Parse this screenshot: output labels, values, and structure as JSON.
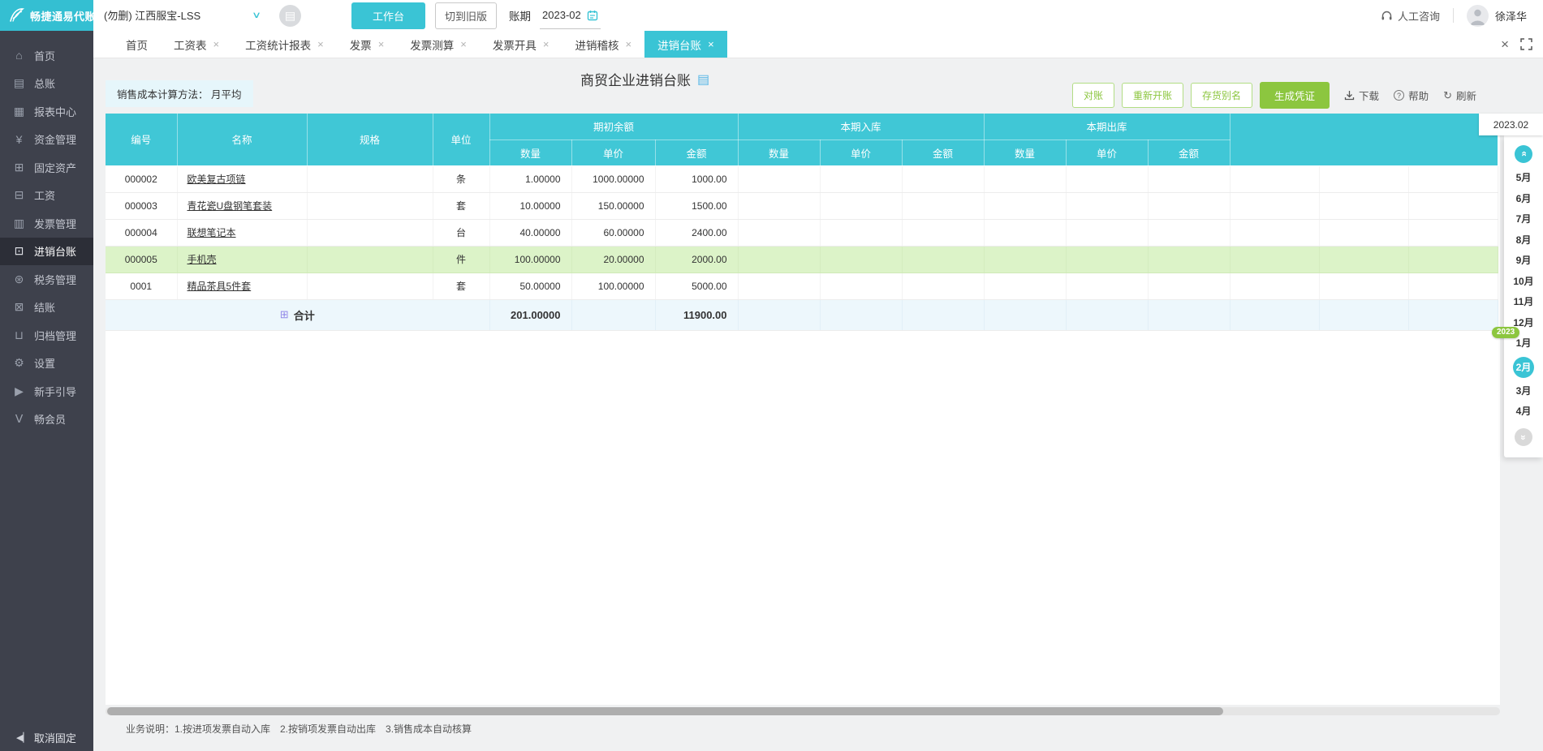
{
  "brand": {
    "name": "畅捷通易代账"
  },
  "topbar": {
    "company": "(勿删) 江西服宝-LSS",
    "workbench": "工作台",
    "switch_old": "切到旧版",
    "period_label": "账期",
    "period_value": "2023-02",
    "support": "人工咨询",
    "user": "徐泽华"
  },
  "sidebar": {
    "items": [
      {
        "label": "首页",
        "icon": "home-icon"
      },
      {
        "label": "总账",
        "icon": "ledger-icon"
      },
      {
        "label": "报表中心",
        "icon": "report-center-icon"
      },
      {
        "label": "资金管理",
        "icon": "funds-icon"
      },
      {
        "label": "固定资产",
        "icon": "fixed-assets-icon"
      },
      {
        "label": "工资",
        "icon": "payroll-icon"
      },
      {
        "label": "发票管理",
        "icon": "invoice-icon"
      },
      {
        "label": "进销台账",
        "icon": "inventory-ledger-icon"
      },
      {
        "label": "税务管理",
        "icon": "tax-icon"
      },
      {
        "label": "结账",
        "icon": "closing-icon"
      },
      {
        "label": "归档管理",
        "icon": "archive-icon"
      },
      {
        "label": "设置",
        "icon": "settings-icon"
      },
      {
        "label": "新手引导",
        "icon": "guide-icon"
      },
      {
        "label": "畅会员",
        "icon": "member-icon"
      }
    ],
    "unpin": "取消固定"
  },
  "tabs": [
    {
      "label": "首页"
    },
    {
      "label": "工资表"
    },
    {
      "label": "工资统计报表"
    },
    {
      "label": "发票"
    },
    {
      "label": "发票测算"
    },
    {
      "label": "发票开具"
    },
    {
      "label": "进销稽核"
    },
    {
      "label": "进销台账"
    }
  ],
  "page": {
    "cost_method_label": "销售成本计算方法：",
    "cost_method_value": "月平均",
    "title": "商贸企业进销台账"
  },
  "toolbar": {
    "reconcile": "对账",
    "reopen": "重新开账",
    "stock_alias": "存货别名",
    "make_voucher": "生成凭证",
    "download": "下载",
    "help": "帮助",
    "refresh": "刷新"
  },
  "table": {
    "head": {
      "code": "编号",
      "name": "名称",
      "spec": "规格",
      "unit": "单位"
    },
    "groups": [
      {
        "label": "期初余额",
        "cols": [
          "数量",
          "单价",
          "金额"
        ]
      },
      {
        "label": "本期入库",
        "cols": [
          "数量",
          "单价",
          "金额"
        ]
      },
      {
        "label": "本期出库",
        "cols": [
          "数量",
          "单价",
          "金额"
        ]
      }
    ],
    "rows": [
      {
        "code": "000002",
        "name": "欧美复古项链",
        "spec": "",
        "unit": "条",
        "qty": "1.00000",
        "price": "1000.00000",
        "amount": "1000.00"
      },
      {
        "code": "000003",
        "name": "青花瓷U盘钢笔套装",
        "spec": "",
        "unit": "套",
        "qty": "10.00000",
        "price": "150.00000",
        "amount": "1500.00"
      },
      {
        "code": "000004",
        "name": "联想笔记本",
        "spec": "",
        "unit": "台",
        "qty": "40.00000",
        "price": "60.00000",
        "amount": "2400.00"
      },
      {
        "code": "000005",
        "name": "手机壳",
        "spec": "",
        "unit": "件",
        "qty": "100.00000",
        "price": "20.00000",
        "amount": "2000.00"
      },
      {
        "code": "0001",
        "name": "精品茶具5件套",
        "spec": "",
        "unit": "套",
        "qty": "50.00000",
        "price": "100.00000",
        "amount": "5000.00"
      }
    ],
    "total": {
      "label": "合计",
      "qty": "201.00000",
      "amount": "11900.00"
    }
  },
  "footer": {
    "note": "业务说明：1.按进项发票自动入库　2.按销项发票自动出库　3.销售成本自动核算"
  },
  "calendar": {
    "period": "2023.02",
    "months_top": [
      "5月",
      "6月",
      "7月",
      "8月",
      "9月",
      "10月",
      "11月",
      "12月"
    ],
    "year_badge": "2023",
    "months_bottom": [
      "1月",
      "2月",
      "3月",
      "4月"
    ],
    "selected_month": "2月"
  }
}
